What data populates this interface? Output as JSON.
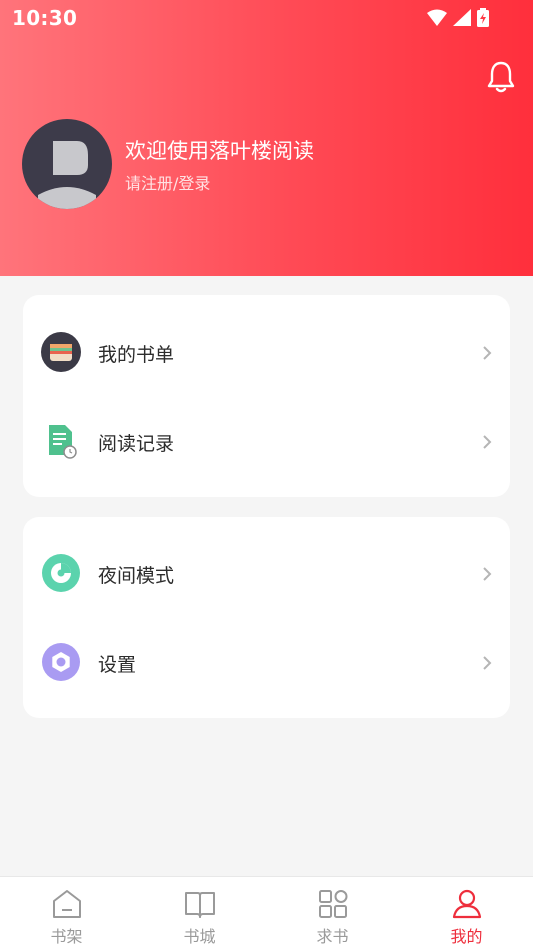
{
  "status_bar": {
    "time": "10:30"
  },
  "profile": {
    "welcome_text": "欢迎使用落叶楼阅读",
    "login_text": "请注册/登录"
  },
  "menu_group_1": [
    {
      "label": "我的书单",
      "icon": "wallet-icon"
    },
    {
      "label": "阅读记录",
      "icon": "document-clock-icon"
    }
  ],
  "menu_group_2": [
    {
      "label": "夜间模式",
      "icon": "moon-icon"
    },
    {
      "label": "设置",
      "icon": "gear-icon"
    }
  ],
  "tabbar": [
    {
      "label": "书架",
      "icon": "home-icon"
    },
    {
      "label": "书城",
      "icon": "book-icon"
    },
    {
      "label": "求书",
      "icon": "grid-icon"
    },
    {
      "label": "我的",
      "icon": "user-icon",
      "active": true
    }
  ],
  "colors": {
    "header_gradient_start": "#ff747b",
    "header_gradient_end": "#ff2f3c",
    "active_tab": "#ee2e3c",
    "inactive_tab": "#9a9a9a"
  }
}
